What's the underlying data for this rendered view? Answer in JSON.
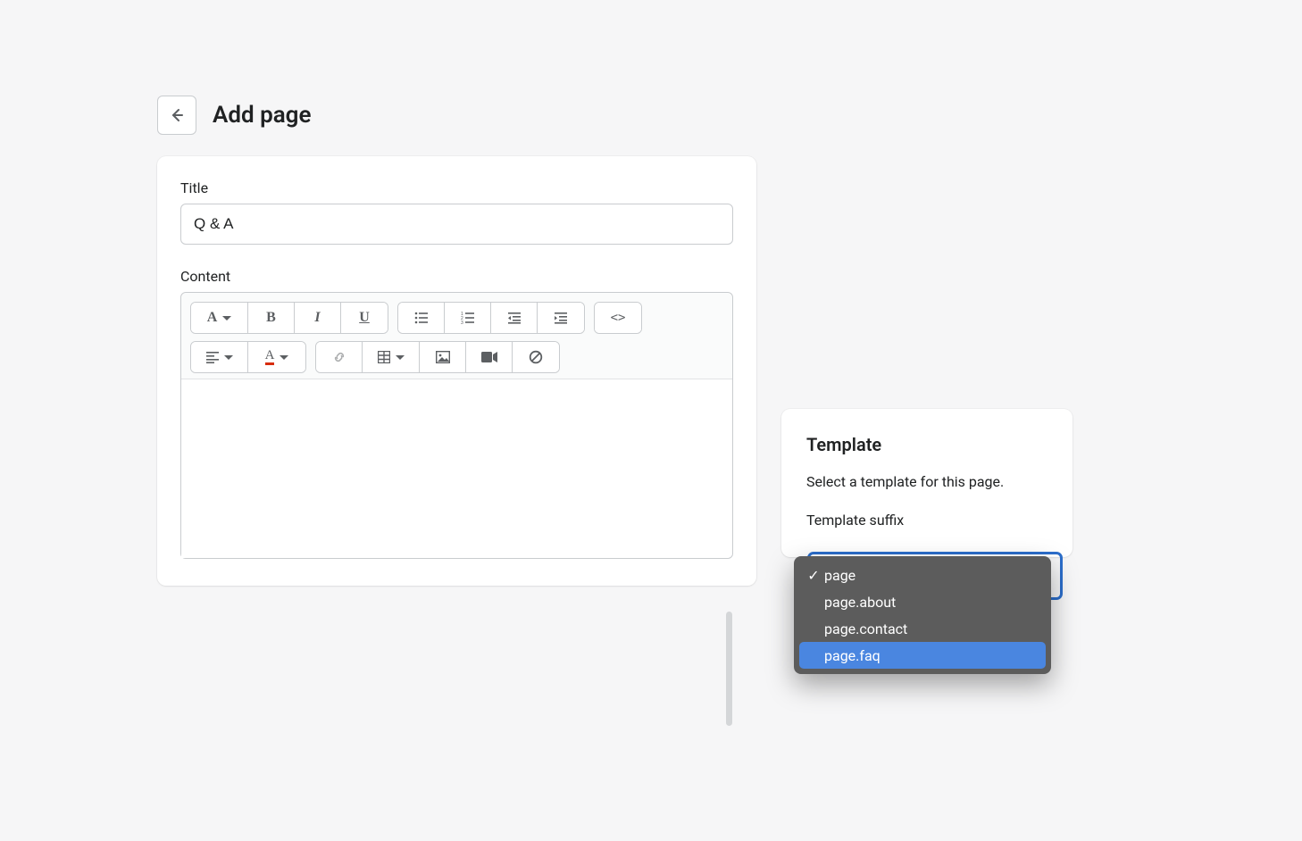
{
  "header": {
    "page_title": "Add page"
  },
  "main": {
    "title_label": "Title",
    "title_value": "Q & A",
    "content_label": "Content"
  },
  "toolbar": {
    "heading_icon": "A",
    "bold_icon": "B",
    "italic_icon": "I",
    "underline_icon": "U",
    "code_icon": "<>",
    "textcolor_icon": "A"
  },
  "template": {
    "card_title": "Template",
    "description": "Select a template for this page.",
    "suffix_label": "Template suffix",
    "selected": "page",
    "options": [
      {
        "label": "page",
        "checked": true,
        "highlighted": false
      },
      {
        "label": "page.about",
        "checked": false,
        "highlighted": false
      },
      {
        "label": "page.contact",
        "checked": false,
        "highlighted": false
      },
      {
        "label": "page.faq",
        "checked": false,
        "highlighted": true
      }
    ]
  }
}
